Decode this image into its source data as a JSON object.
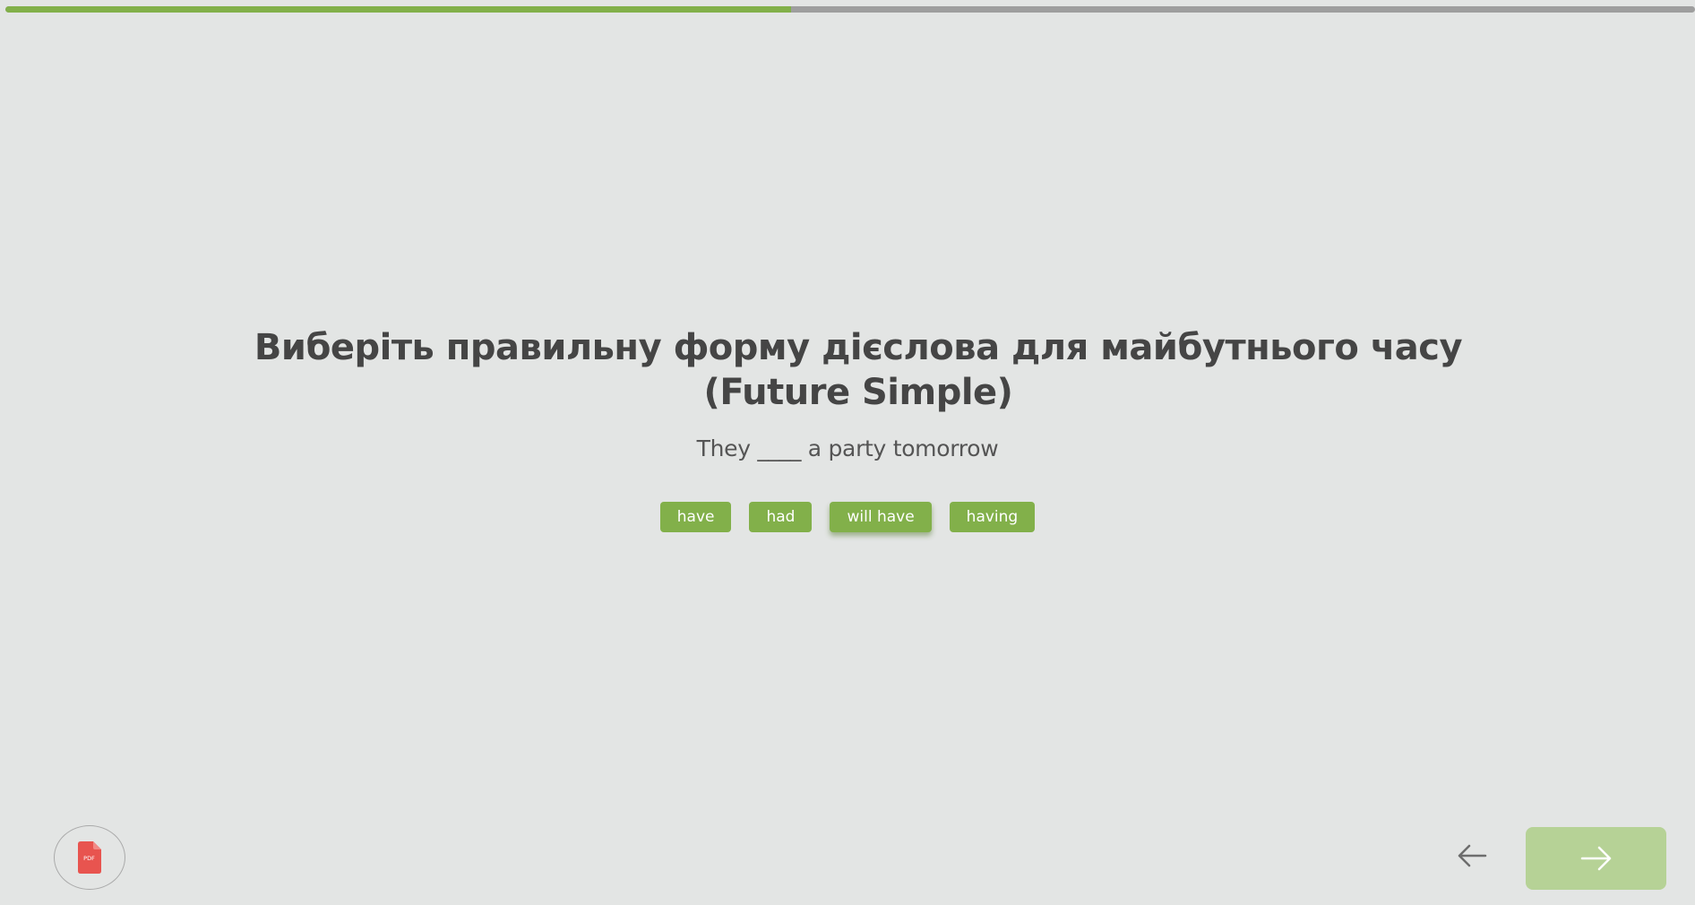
{
  "progress": {
    "fraction": 0.465,
    "fill_color": "#82b04a",
    "track_color": "#9e9e9e"
  },
  "question": {
    "title": "Виберіть правильну форму дієслова для майбутнього часу (Future Simple)",
    "sentence": "They ____ a party tomorrow"
  },
  "options": [
    {
      "label": "have"
    },
    {
      "label": "had"
    },
    {
      "label": "will have"
    },
    {
      "label": "having"
    }
  ],
  "footer": {
    "pdf_icon": "pdf-file-icon",
    "pdf_icon_text": "PDF",
    "back_icon": "arrow-left-icon",
    "next_icon": "arrow-right-icon"
  },
  "colors": {
    "accent": "#82b04a",
    "next_button": "#b6d296",
    "background": "#e3e5e4",
    "title_text": "#454545",
    "pdf_icon": "#e8544f"
  }
}
